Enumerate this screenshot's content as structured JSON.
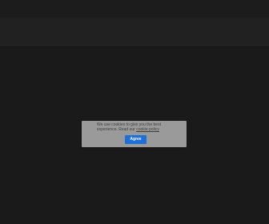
{
  "cookie_banner": {
    "message": "We use cookies to give you the best experience. Read our",
    "link_label": "cookie policy",
    "agree_label": "Agree"
  },
  "colors": {
    "background": "#1e1e1e",
    "header": "#262626",
    "dialog": "#9a9a9a",
    "button": "#1f6fd9"
  }
}
